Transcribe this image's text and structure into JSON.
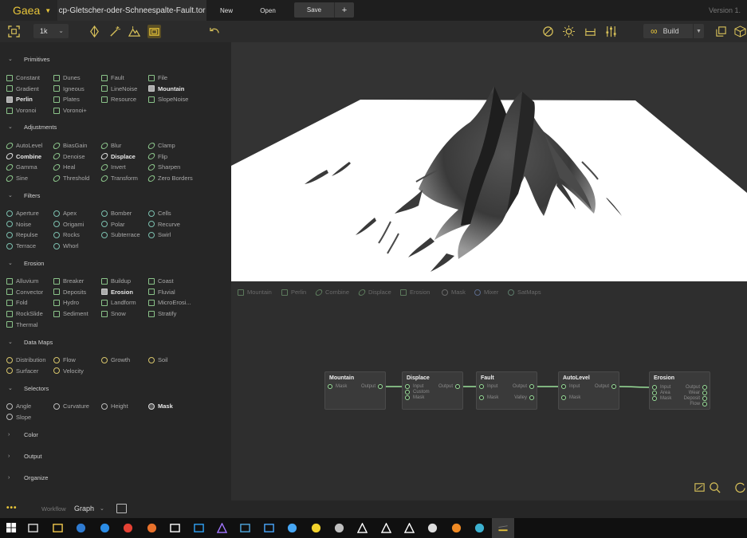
{
  "app": {
    "brand": "Gaea",
    "file_tab": "cp-Gletscher-oder-Schneespalte-Fault.tor",
    "new_label": "New",
    "open_label": "Open",
    "save_label": "Save",
    "add_label": "+",
    "version": "Version 1."
  },
  "toolbar": {
    "resolution": "1k",
    "build_label": "Build"
  },
  "sidebar": {
    "sections": [
      {
        "title": "Primitives",
        "expanded": true
      },
      {
        "title": "Adjustments",
        "expanded": true
      },
      {
        "title": "Filters",
        "expanded": true
      },
      {
        "title": "Erosion",
        "expanded": true
      },
      {
        "title": "Data Maps",
        "expanded": true
      },
      {
        "title": "Selectors",
        "expanded": true
      },
      {
        "title": "Color",
        "expanded": false
      },
      {
        "title": "Output",
        "expanded": false
      },
      {
        "title": "Organize",
        "expanded": false
      }
    ],
    "primitives": [
      "Constant",
      "Dunes",
      "Fault",
      "File",
      "Gradient",
      "Igneous",
      "LineNoise",
      "Mountain",
      "Perlin",
      "Plates",
      "Resource",
      "SlopeNoise",
      "Voronoi",
      "Voronoi+"
    ],
    "adjustments": [
      "AutoLevel",
      "BiasGain",
      "Blur",
      "Clamp",
      "Combine",
      "Denoise",
      "Displace",
      "Flip",
      "Gamma",
      "Heal",
      "Invert",
      "Sharpen",
      "Sine",
      "Threshold",
      "Transform",
      "Zero Borders"
    ],
    "filters": [
      "Aperture",
      "Apex",
      "Bomber",
      "Cells",
      "Noise",
      "Origami",
      "Polar",
      "Recurve",
      "Repulse",
      "Rocks",
      "Subterrace",
      "Swirl",
      "Terrace",
      "Whorl"
    ],
    "erosion": [
      "Alluvium",
      "Breaker",
      "Buildup",
      "Coast",
      "Convector",
      "Deposits",
      "Erosion",
      "Fluvial",
      "Fold",
      "Hydro",
      "Landform",
      "MicroErosi...",
      "RockSlide",
      "Sediment",
      "Snow",
      "Stratify",
      "Thermal"
    ],
    "datamaps": [
      "Distribution",
      "Flow",
      "Growth",
      "Soil",
      "Surfacer",
      "Velocity"
    ],
    "selectors": [
      "Angle",
      "Curvature",
      "Height",
      "Mask",
      "Slope"
    ]
  },
  "graph": {
    "filters": [
      "Mountain",
      "Perlin",
      "Combine",
      "Displace",
      "Erosion",
      "Mask",
      "Mixer",
      "SatMaps"
    ],
    "nodes": [
      {
        "title": "Mountain",
        "inputs": [
          "Mask"
        ],
        "outputs": [
          "Output"
        ]
      },
      {
        "title": "Displace",
        "inputs": [
          "Input",
          "Custom",
          "Mask"
        ],
        "outputs": [
          "Output"
        ]
      },
      {
        "title": "Fault",
        "inputs": [
          "Input",
          "Mask"
        ],
        "outputs": [
          "Output",
          "Valley"
        ]
      },
      {
        "title": "AutoLevel",
        "inputs": [
          "Input",
          "Mask"
        ],
        "outputs": [
          "Output"
        ]
      },
      {
        "title": "Erosion",
        "inputs": [
          "Input",
          "Area",
          "Mask"
        ],
        "outputs": [
          "Output",
          "Wear",
          "Deposit",
          "Flow"
        ]
      }
    ]
  },
  "statusbar": {
    "dots": "•••",
    "workflow_label": "Workflow",
    "workflow_value": "Graph"
  },
  "colors": {
    "accent": "#e8c53a",
    "wire": "#9ae09a",
    "primitive": "#8bc48a",
    "filter": "#7bbfae",
    "datamap": "#d6c46b"
  }
}
